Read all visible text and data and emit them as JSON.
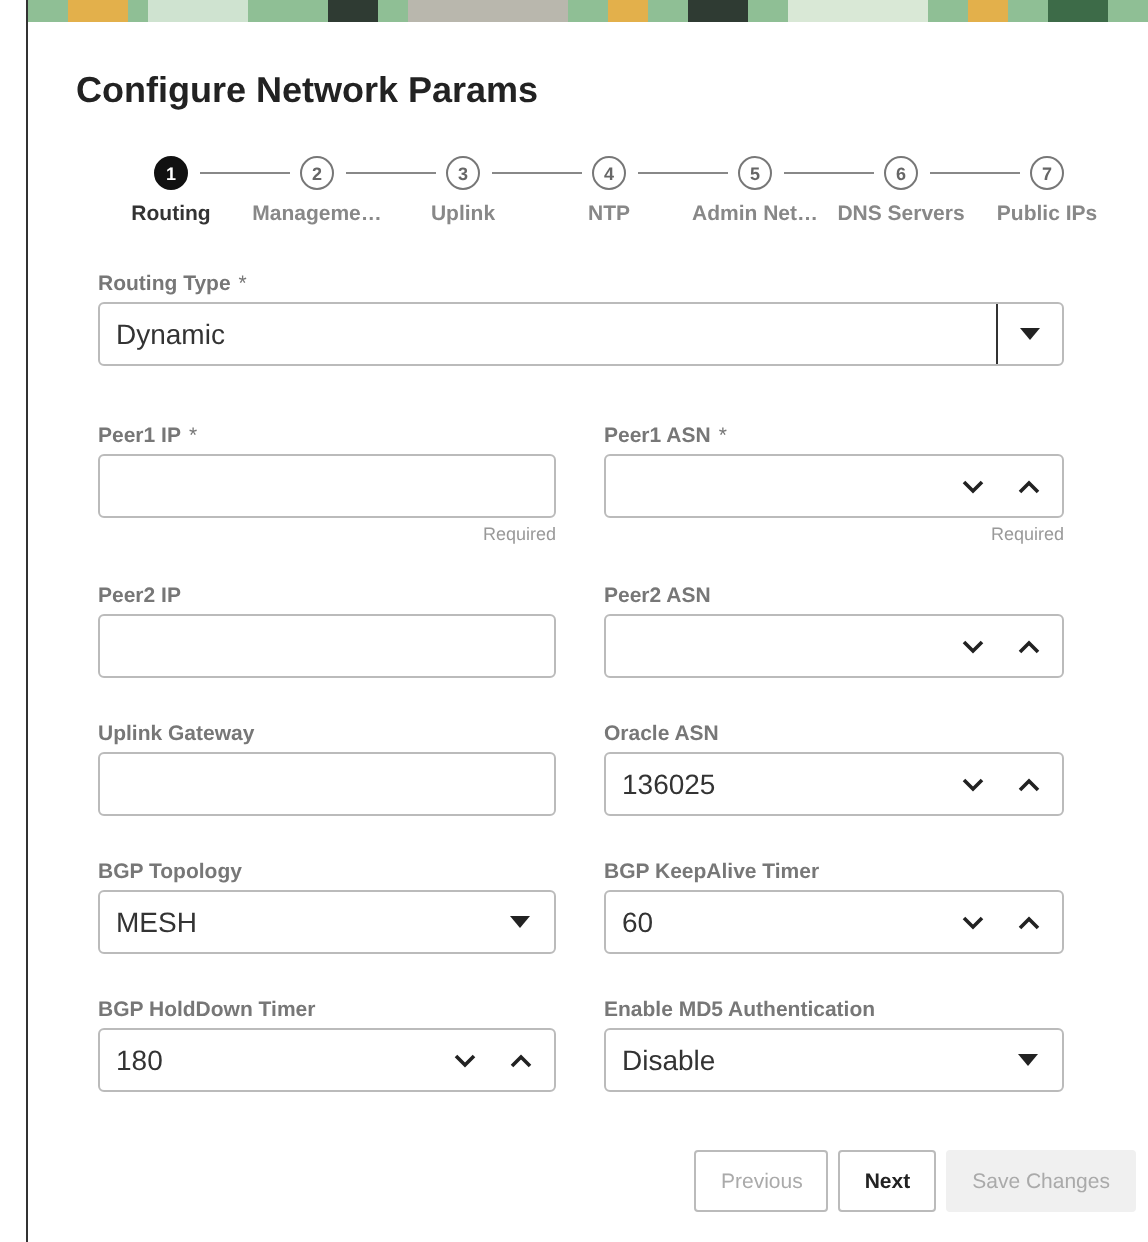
{
  "dialog": {
    "title": "Configure Network Params"
  },
  "steps": [
    {
      "number": "1",
      "label": "Routing",
      "selected": true
    },
    {
      "number": "2",
      "label": "Manageme…",
      "selected": false
    },
    {
      "number": "3",
      "label": "Uplink",
      "selected": false
    },
    {
      "number": "4",
      "label": "NTP",
      "selected": false
    },
    {
      "number": "5",
      "label": "Admin Net…",
      "selected": false
    },
    {
      "number": "6",
      "label": "DNS Servers",
      "selected": false
    },
    {
      "number": "7",
      "label": "Public IPs",
      "selected": false
    }
  ],
  "routing_type": {
    "label": "Routing Type",
    "required_mark": "*",
    "value": "Dynamic",
    "kind": "combobox"
  },
  "fields": [
    {
      "label": "Peer1 IP",
      "required_mark": "*",
      "kind": "text",
      "helper": "Required"
    },
    {
      "label": "Peer1 ASN",
      "required_mark": "*",
      "kind": "number",
      "helper": "Required"
    },
    {
      "label": "Peer2 IP",
      "kind": "text"
    },
    {
      "label": "Peer2 ASN",
      "kind": "number"
    },
    {
      "label": "Uplink Gateway",
      "kind": "text"
    },
    {
      "label": "Oracle ASN",
      "kind": "number",
      "value": "136025"
    },
    {
      "label": "BGP Topology",
      "kind": "select",
      "value": "MESH"
    },
    {
      "label": "BGP KeepAlive Timer",
      "kind": "number",
      "value": "60"
    },
    {
      "label": "BGP HoldDown Timer",
      "kind": "number",
      "value": "180"
    },
    {
      "label": "Enable MD5 Authentication",
      "kind": "select",
      "value": "Disable"
    }
  ],
  "buttons": [
    {
      "label": "Previous",
      "kind": "outline",
      "disabled": true
    },
    {
      "label": "Next",
      "kind": "outline",
      "disabled": false
    },
    {
      "label": "Save Changes",
      "kind": "filled",
      "disabled": true
    }
  ]
}
